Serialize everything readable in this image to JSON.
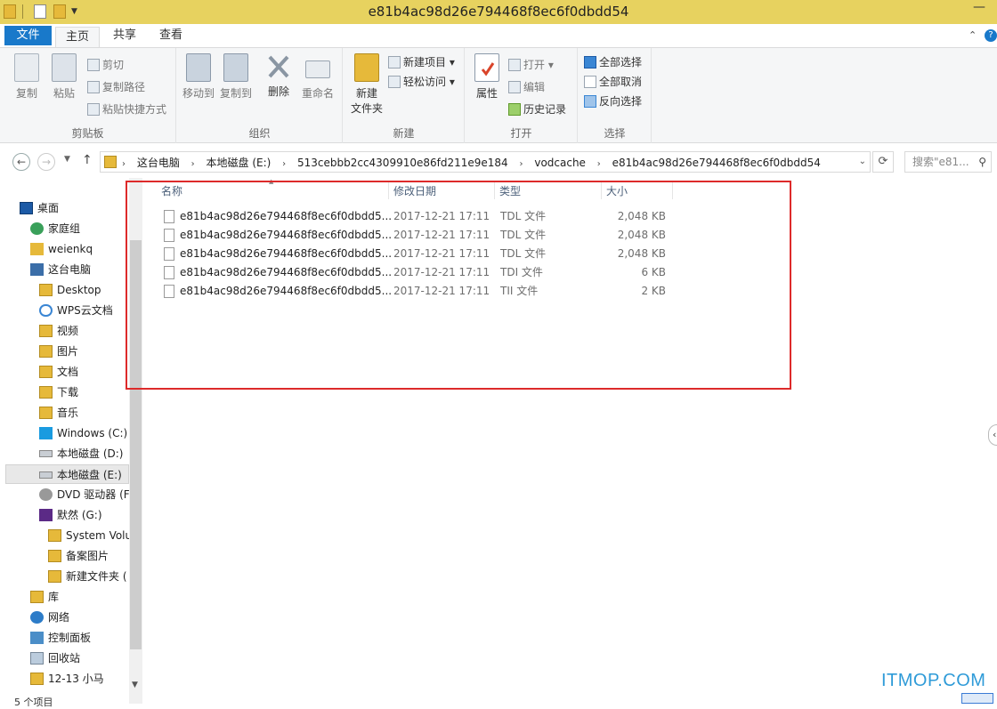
{
  "window": {
    "title": "e81b4ac98d26e794468f8ec6f0dbdd54"
  },
  "tabs": [
    {
      "label": "文件"
    },
    {
      "label": "主页"
    },
    {
      "label": "共享"
    },
    {
      "label": "查看"
    }
  ],
  "ribbon": {
    "clipboard": {
      "copy": "复制",
      "paste": "粘贴",
      "cut": "剪切",
      "copy_path": "复制路径",
      "paste_shortcut": "粘贴快捷方式",
      "label": "剪贴板"
    },
    "organize": {
      "move_to": "移动到",
      "copy_to": "复制到",
      "delete": "删除",
      "rename": "重命名",
      "label": "组织"
    },
    "new": {
      "new_folder_line1": "新建",
      "new_folder_line2": "文件夹",
      "new_item": "新建项目",
      "easy_access": "轻松访问",
      "label": "新建"
    },
    "open": {
      "properties": "属性",
      "open": "打开",
      "edit": "编辑",
      "history": "历史记录",
      "label": "打开"
    },
    "select": {
      "select_all": "全部选择",
      "select_none": "全部取消",
      "invert": "反向选择",
      "label": "选择"
    }
  },
  "address": {
    "crumbs": [
      "这台电脑",
      "本地磁盘 (E:)",
      "513cebbb2cc4309910e86fd211e9e184",
      "vodcache",
      "e81b4ac98d26e794468f8ec6f0dbdd54"
    ],
    "search_placeholder": "搜索\"e81..."
  },
  "nav": [
    {
      "label": "桌面"
    },
    {
      "label": "家庭组"
    },
    {
      "label": "weienkq"
    },
    {
      "label": "这台电脑"
    },
    {
      "label": "Desktop"
    },
    {
      "label": "WPS云文档"
    },
    {
      "label": "视频"
    },
    {
      "label": "图片"
    },
    {
      "label": "文档"
    },
    {
      "label": "下载"
    },
    {
      "label": "音乐"
    },
    {
      "label": "Windows (C:)"
    },
    {
      "label": "本地磁盘 (D:)"
    },
    {
      "label": "本地磁盘 (E:)"
    },
    {
      "label": "DVD 驱动器 (F"
    },
    {
      "label": "默然 (G:)"
    },
    {
      "label": "System Volu"
    },
    {
      "label": "备案图片"
    },
    {
      "label": "新建文件夹 ("
    },
    {
      "label": "库"
    },
    {
      "label": "网络"
    },
    {
      "label": "控制面板"
    },
    {
      "label": "回收站"
    },
    {
      "label": "12-13 小马"
    }
  ],
  "columns": {
    "name": "名称",
    "date": "修改日期",
    "type": "类型",
    "size": "大小"
  },
  "files": [
    {
      "name": "e81b4ac98d26e794468f8ec6f0dbdd5...",
      "date": "2017-12-21 17:11",
      "type": "TDL 文件",
      "size": "2,048 KB"
    },
    {
      "name": "e81b4ac98d26e794468f8ec6f0dbdd5...",
      "date": "2017-12-21 17:11",
      "type": "TDL 文件",
      "size": "2,048 KB"
    },
    {
      "name": "e81b4ac98d26e794468f8ec6f0dbdd5...",
      "date": "2017-12-21 17:11",
      "type": "TDL 文件",
      "size": "2,048 KB"
    },
    {
      "name": "e81b4ac98d26e794468f8ec6f0dbdd5...",
      "date": "2017-12-21 17:11",
      "type": "TDI 文件",
      "size": "6 KB"
    },
    {
      "name": "e81b4ac98d26e794468f8ec6f0dbdd5...",
      "date": "2017-12-21 17:11",
      "type": "TII 文件",
      "size": "2 KB"
    }
  ],
  "status": {
    "text": "5 个项目"
  },
  "watermark": "ITMOP.COM",
  "colors": {
    "accent": "#1979ca",
    "titlebar": "#e7d25f",
    "highlight_box": "#dd2a2a",
    "watermark": "#2f9bd8"
  }
}
